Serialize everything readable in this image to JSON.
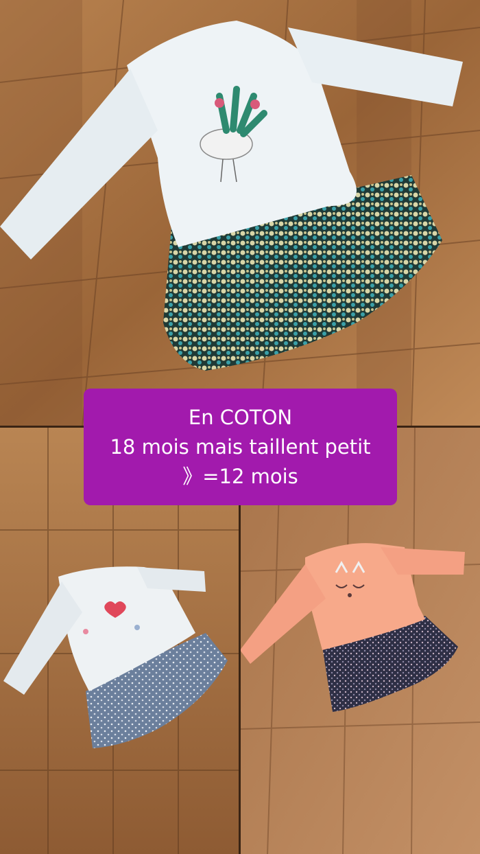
{
  "caption": {
    "line1": "En COTON",
    "line2": "18 mois mais taillent petit",
    "line3": "》=12 mois",
    "background": "#a21aad",
    "text_color": "#ffffff"
  },
  "photos": [
    {
      "subject": "white long-sleeve dress with bird print and teal floral tiered skirt"
    },
    {
      "subject": "white long-sleeve dress with heart print and blue ruffled skirt"
    },
    {
      "subject": "peach long-sleeve dress with cat face print and dark floral tiered skirt"
    }
  ],
  "colors": {
    "wood_light": "#b07a4c",
    "wood_dark": "#7a4a2a",
    "white_top": "#eef3f6",
    "peach_top": "#f7a98a",
    "teal_print": "#2f7a7a",
    "blue_ruffle": "#6b7f9c"
  }
}
